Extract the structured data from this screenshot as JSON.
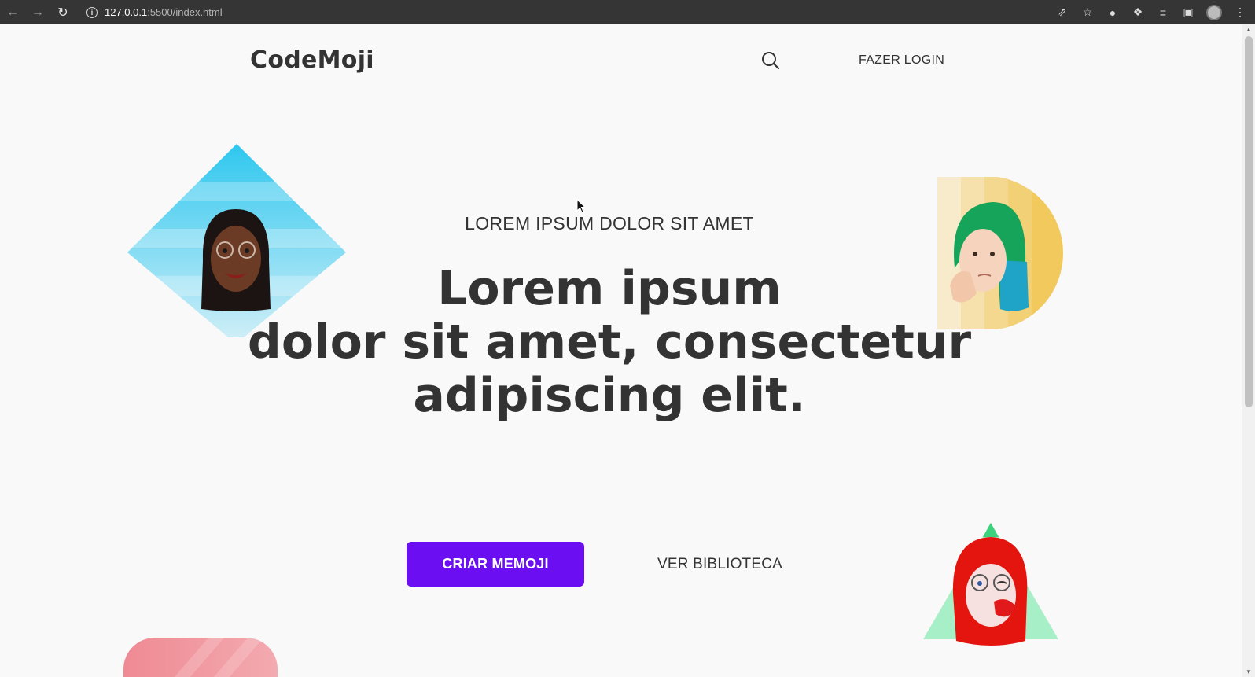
{
  "browser": {
    "url_host": "127.0.0.1",
    "url_path": ":5500/index.html"
  },
  "header": {
    "logo": "CodeMoji",
    "login_label": "FAZER LOGIN"
  },
  "hero": {
    "subtitle": "LOREM IPSUM DOLOR SIT AMET",
    "headline_lines": [
      "Lorem ipsum",
      "dolor sit amet, consectetur",
      "adipiscing elit."
    ]
  },
  "actions": {
    "primary_label": "CRIAR MEMOJI",
    "secondary_label": "VER BIBLIOTECA"
  },
  "colors": {
    "accent": "#6b0ff2",
    "text": "#333333",
    "background": "#f9f9f9"
  },
  "icons": {
    "search": "search-icon",
    "back": "arrow-left-icon",
    "forward": "arrow-right-icon",
    "reload": "reload-icon"
  }
}
